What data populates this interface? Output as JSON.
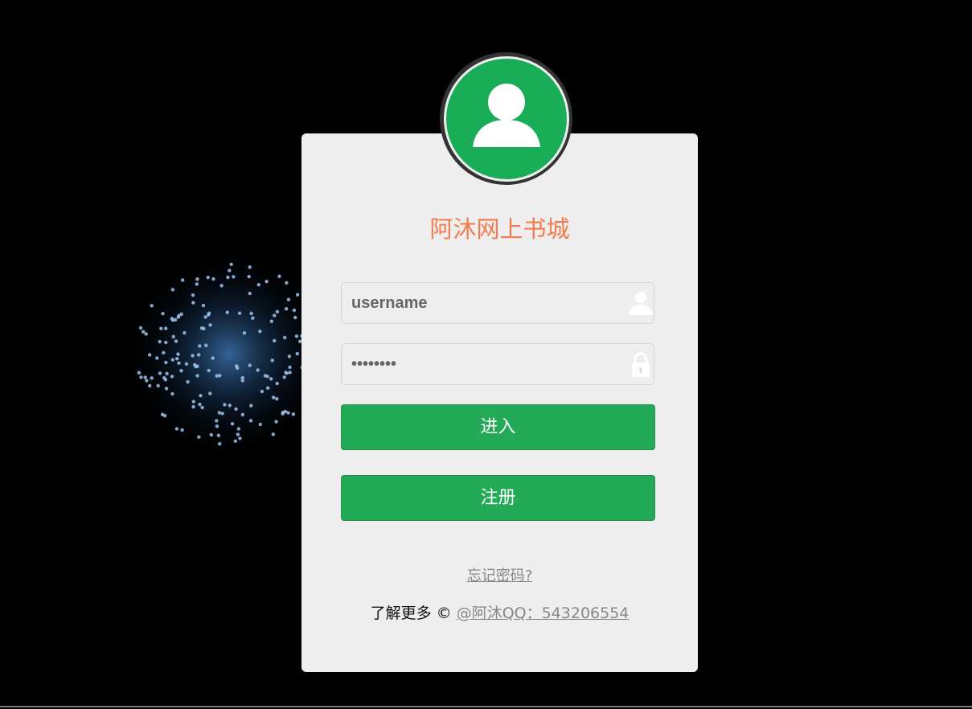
{
  "app": {
    "title": "阿沐网上书城"
  },
  "form": {
    "username": {
      "value": "username",
      "icon": "user-icon"
    },
    "password": {
      "value": "12345678",
      "icon": "lock-icon"
    },
    "login_label": "进入",
    "register_label": "注册",
    "forgot_label": "忘记密码?"
  },
  "footer": {
    "prefix": "了解更多 ©",
    "link_label": "@阿沐QQ：543206554"
  },
  "colors": {
    "accent": "#1aad57",
    "title": "#f47a4d",
    "background": "#000000",
    "firework": "#4a8fd6"
  }
}
